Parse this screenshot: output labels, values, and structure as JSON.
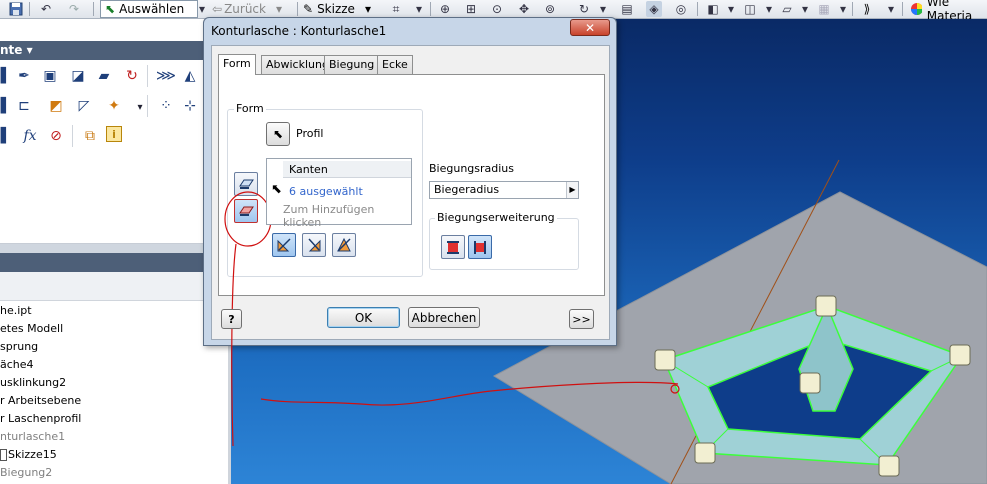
{
  "toolbar": {
    "back_label": "Zurück",
    "select_label": "Auswählen",
    "sketch_label": "Skizze",
    "material_label": "Wie Materia"
  },
  "ribbon": {
    "panel_title": "nte ▾",
    "fx_label": "fx"
  },
  "browser": {
    "items": [
      {
        "label": "he.ipt",
        "dim": false
      },
      {
        "label": "etes Modell",
        "dim": false
      },
      {
        "label": "sprung",
        "dim": false
      },
      {
        "label": "äche4",
        "dim": false
      },
      {
        "label": "usklinkung2",
        "dim": false
      },
      {
        "label": "r Arbeitsebene",
        "dim": false
      },
      {
        "label": "r Laschenprofil",
        "dim": false
      },
      {
        "label": "nturlasche1",
        "dim": true
      },
      {
        "label": "Skizze15",
        "dim": false
      },
      {
        "label": "Biegung2",
        "dim": true
      }
    ]
  },
  "dialog": {
    "title": "Konturlasche : Konturlasche1",
    "close_label": "✕",
    "tabs": [
      "Form",
      "Abwicklung",
      "Biegung",
      "Ecke"
    ],
    "form_group_label": "Form",
    "profile_label": "Profil",
    "edges_header": "Kanten",
    "edges_selected": "6 ausgewählt",
    "edges_hint": "Zum Hinzufügen klicken",
    "bend_radius_label": "Biegungsradius",
    "bend_radius_value": "Biegeradius",
    "bend_extension_label": "Biegungserweiterung",
    "ok_label": "OK",
    "cancel_label": "Abbrechen",
    "more_label": ">>",
    "help_label": "?"
  },
  "colors": {
    "viewport_top": "#0a2a66",
    "viewport_bottom": "#2d84d6",
    "plane": "#9aa0aa",
    "flange_edge": "#3cff3c",
    "annotation": "#d01010"
  }
}
